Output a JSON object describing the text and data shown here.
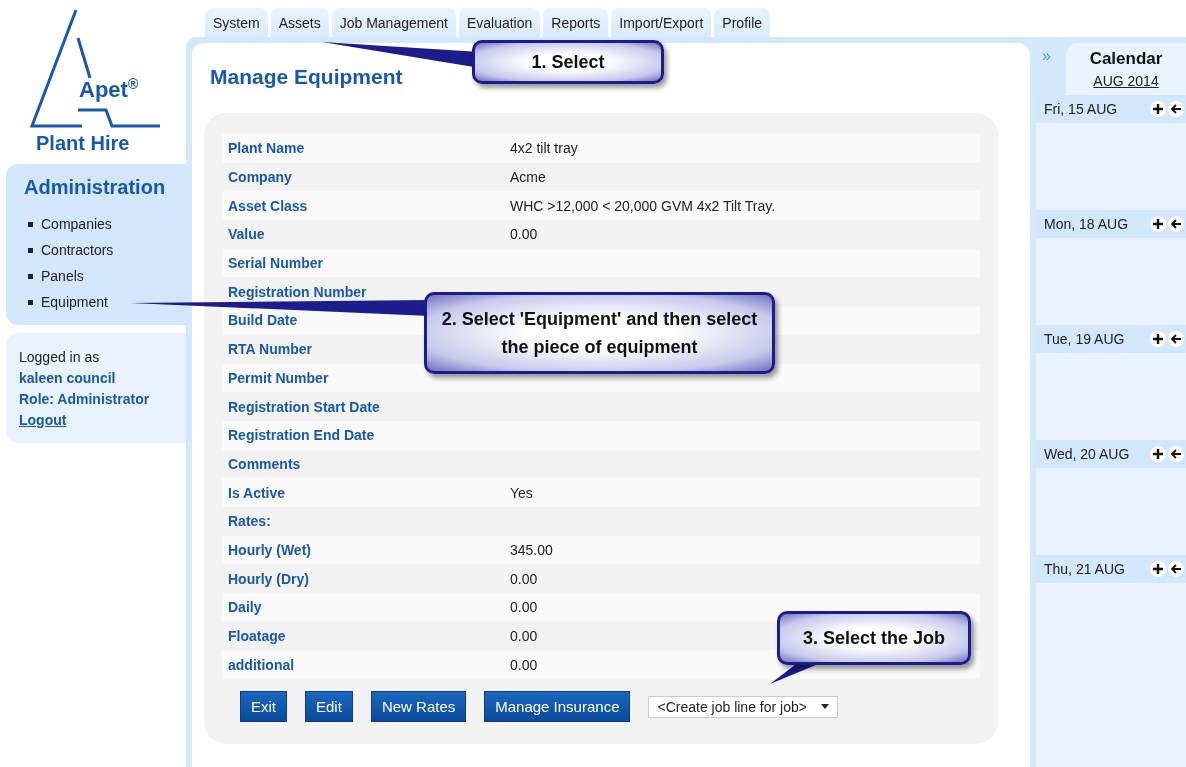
{
  "logo": {
    "brand": "Apet",
    "mark": "®",
    "tagline": "Plant Hire"
  },
  "tabs": [
    {
      "label": "System"
    },
    {
      "label": "Assets"
    },
    {
      "label": "Job Management"
    },
    {
      "label": "Evaluation"
    },
    {
      "label": "Reports"
    },
    {
      "label": "Import/Export"
    },
    {
      "label": "Profile"
    }
  ],
  "sidebar": {
    "title": "Administration",
    "items": [
      "Companies",
      "Contractors",
      "Panels",
      "Equipment"
    ]
  },
  "user": {
    "prefix": "Logged in as",
    "name": "kaleen council",
    "role": "Role: Administrator",
    "logout": "Logout"
  },
  "page_title": "Manage Equipment",
  "fields": [
    {
      "label": "Plant Name",
      "value": "4x2 tilt tray"
    },
    {
      "label": "Company",
      "value": "Acme"
    },
    {
      "label": "Asset Class",
      "value": "WHC >12,000 < 20,000 GVM 4x2 Tilt Tray."
    },
    {
      "label": "Value",
      "value": "0.00"
    },
    {
      "label": "Serial Number"
    },
    {
      "label": "Registration Number"
    },
    {
      "label": "Build Date"
    },
    {
      "label": "RTA Number"
    },
    {
      "label": "Permit Number"
    },
    {
      "label": "Registration Start Date"
    },
    {
      "label": "Registration End Date"
    },
    {
      "label": "Comments"
    },
    {
      "label": "Is Active",
      "value": "Yes"
    },
    {
      "label": "Rates:"
    },
    {
      "label": "Hourly (Wet)",
      "value": "345.00"
    },
    {
      "label": "Hourly (Dry)",
      "value": "0.00"
    },
    {
      "label": "Daily",
      "value": "0.00"
    },
    {
      "label": "Floatage",
      "value": "0.00"
    },
    {
      "label": "additional",
      "value": "0.00"
    }
  ],
  "buttons": [
    "Exit",
    "Edit",
    "New Rates",
    "Manage Insurance"
  ],
  "job_select": {
    "value": "<Create job line for job>"
  },
  "calendar": {
    "toggle": "»",
    "title": "Calendar",
    "month": "AUG 2014",
    "days": [
      "Fri, 15 AUG",
      "Mon, 18 AUG",
      "Tue, 19 AUG",
      "Wed, 20 AUG",
      "Thu, 21 AUG"
    ]
  },
  "callouts": [
    "1. Select",
    "2. Select 'Equipment' and then select the piece of equipment",
    "3. Select the Job"
  ]
}
